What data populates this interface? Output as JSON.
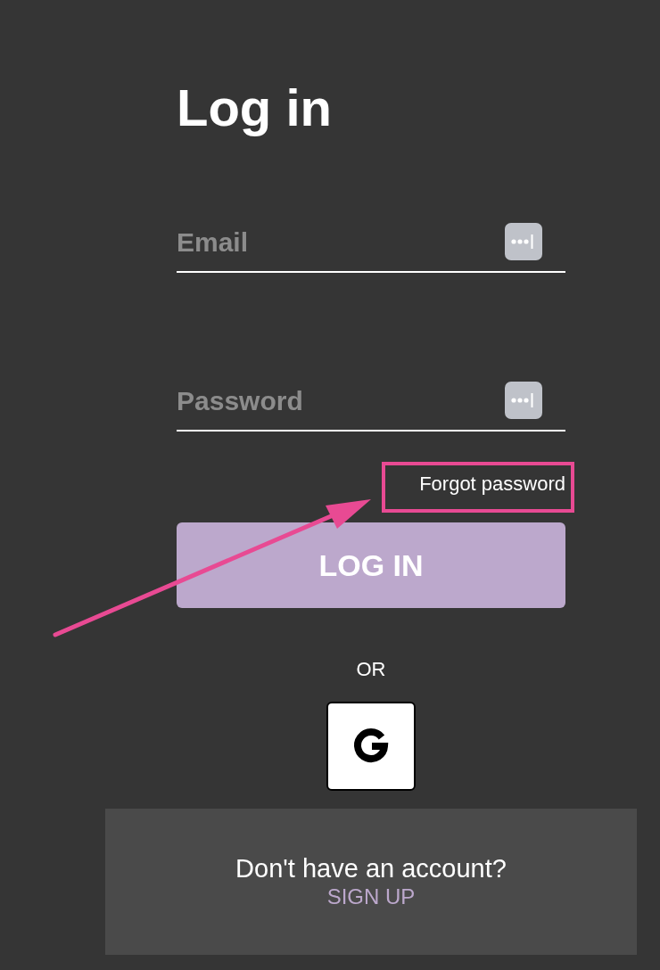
{
  "title": "Log in",
  "fields": [
    {
      "placeholder": "Email"
    },
    {
      "placeholder": "Password"
    }
  ],
  "forgot_link": {
    "text": "Forgot password",
    "highlighted": true
  },
  "login_button": "LOG IN",
  "divider_text": "OR",
  "footer": {
    "prompt": "Don't have an account?",
    "link": "SIGN UP"
  }
}
